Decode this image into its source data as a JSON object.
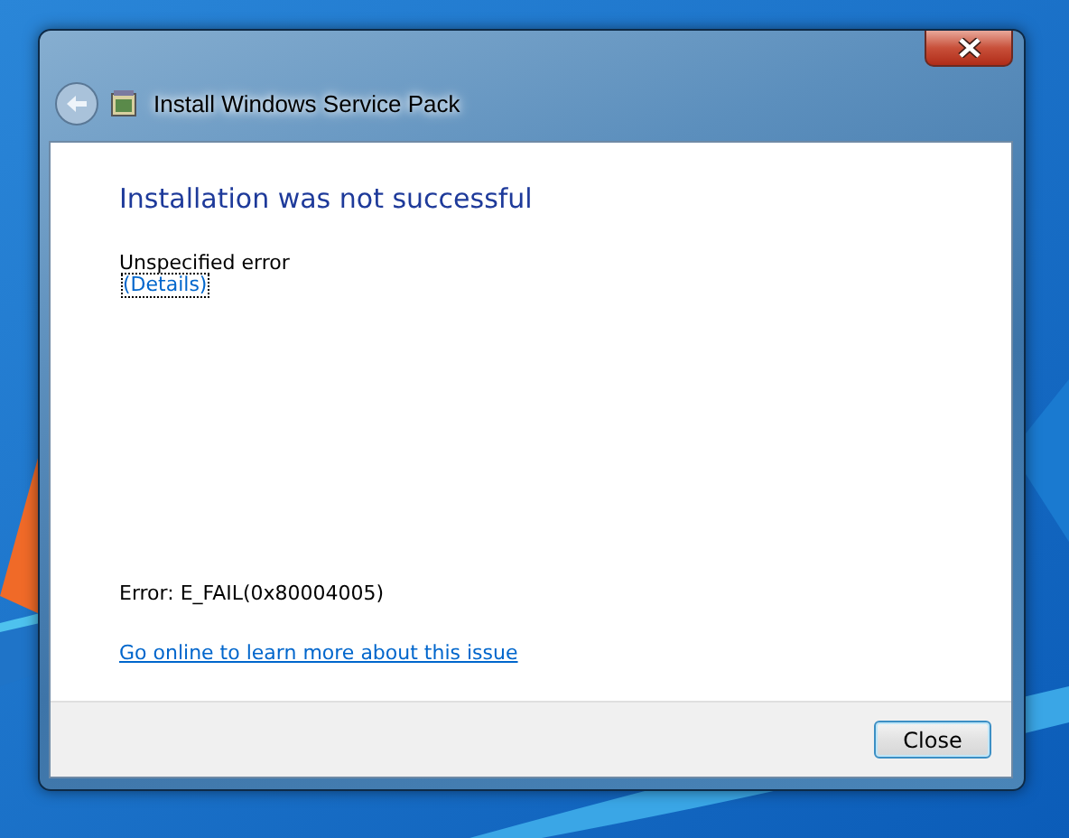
{
  "window": {
    "title": "Install Windows Service Pack"
  },
  "heading": "Installation was not successful",
  "message": "Unspecified error",
  "details_link": "(Details)",
  "error_code": "Error: E_FAIL(0x80004005)",
  "help_link": "Go online to learn more about this issue",
  "buttons": [
    {
      "label": "Close"
    }
  ]
}
